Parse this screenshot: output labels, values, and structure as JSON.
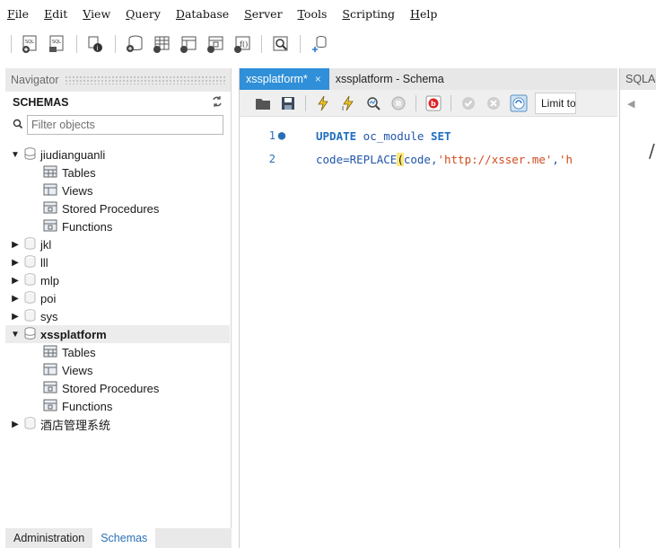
{
  "menubar": {
    "items": [
      {
        "ul": "F",
        "rest": "ile"
      },
      {
        "ul": "E",
        "rest": "dit"
      },
      {
        "ul": "V",
        "rest": "iew"
      },
      {
        "ul": "Q",
        "rest": "uery"
      },
      {
        "ul": "D",
        "rest": "atabase"
      },
      {
        "ul": "S",
        "rest": "erver"
      },
      {
        "ul": "T",
        "rest": "ools"
      },
      {
        "ul": "S",
        "rest": "cripting"
      },
      {
        "ul": "H",
        "rest": "elp"
      }
    ]
  },
  "toolbar": {
    "icons": [
      "new-sql-tab-icon",
      "open-sql-file-icon",
      "inspector-icon",
      "create-schema-icon",
      "create-table-icon",
      "create-view-icon",
      "create-procedure-icon",
      "create-function-icon",
      "search-table-data-icon",
      "reconnect-icon"
    ]
  },
  "navigator": {
    "header": "Navigator",
    "schemas_title": "SCHEMAS",
    "filter_placeholder": "Filter objects",
    "tree": {
      "jiudianguanli": {
        "name": "jiudianguanli",
        "children": [
          "Tables",
          "Views",
          "Stored Procedures",
          "Functions"
        ]
      },
      "jkl": "jkl",
      "lll": "lll",
      "mlp": "mlp",
      "poi": "poi",
      "sys": "sys",
      "xssplatform": {
        "name": "xssplatform",
        "children": [
          "Tables",
          "Views",
          "Stored Procedures",
          "Functions"
        ]
      },
      "hotel": "酒店管理系统"
    },
    "bottom_tabs": {
      "administration": "Administration",
      "schemas": "Schemas"
    }
  },
  "editor": {
    "tabs": {
      "query": "xssplatform*",
      "schema": "xssplatform - Schema"
    },
    "close_glyph": "×",
    "limit_label": "Limit to",
    "lines": {
      "l1": {
        "number": "1",
        "kw1": "UPDATE",
        "text": " oc_module ",
        "kw2": "SET"
      },
      "l2": {
        "number": "2",
        "pre": "code=REPLACE",
        "paren": "(",
        "mid": "code,",
        "s1": "'http://xsser.me'",
        "comma": ",",
        "s2": "'h"
      }
    }
  },
  "right_panel": {
    "header": "SQLAdditions",
    "big_glyph": "/"
  },
  "colors": {
    "accent_tab": "#2f8fd8",
    "keyword": "#1f6fbf",
    "string": "#d04b1f",
    "bracket_highlight": "#ffe87a"
  }
}
